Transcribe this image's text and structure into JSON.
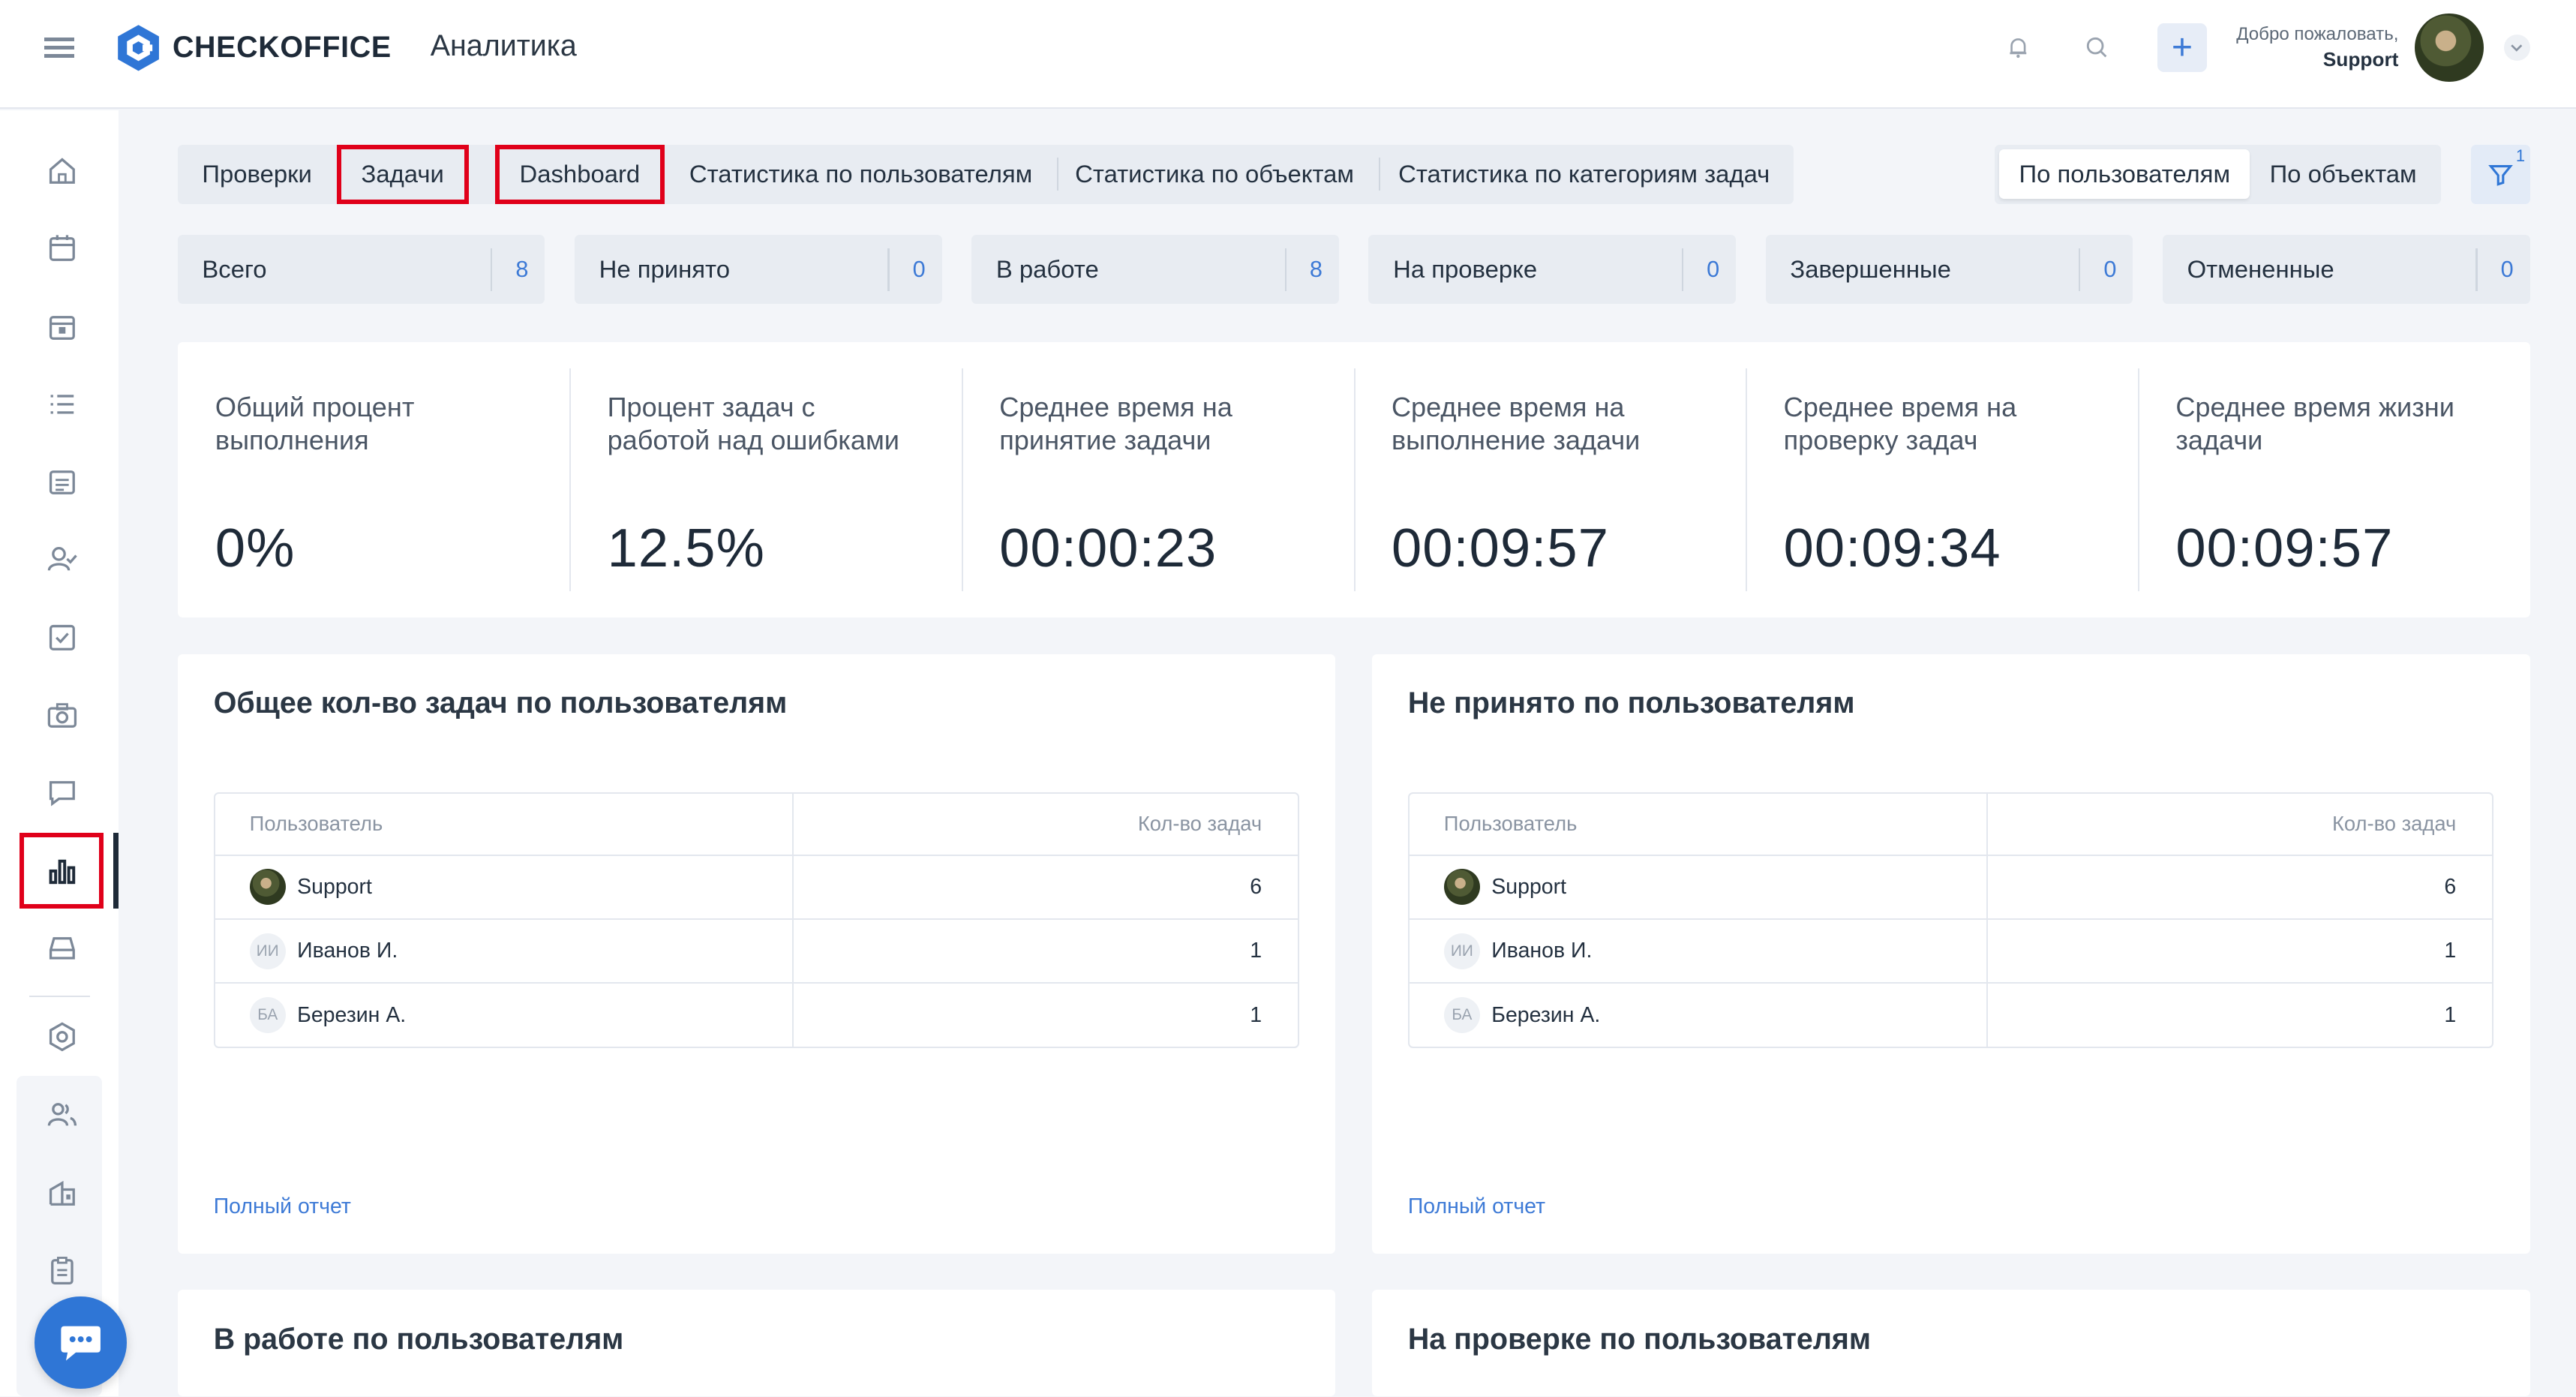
{
  "header": {
    "brand": "CHECKOFFICE",
    "page_title": "Аналитика",
    "welcome": "Добро пожаловать,",
    "user": "Support",
    "add_label": "+"
  },
  "sidebar": {
    "items": [
      "home-icon",
      "calendar-icon",
      "calendar-event-icon",
      "list-icon",
      "schedule-icon",
      "user-check-icon",
      "checkbox-icon",
      "camera-icon",
      "chat-icon",
      "analytics-icon",
      "inbox-icon",
      "settings-icon",
      "users-icon",
      "building-icon",
      "clipboard-icon"
    ],
    "active": "analytics-icon"
  },
  "tabs": {
    "items": [
      "Проверки",
      "Задачи",
      "Dashboard",
      "Статистика по пользователям",
      "Статистика по объектам",
      "Статистика по категориям задач"
    ]
  },
  "view_toggle": {
    "options": [
      "По пользователям",
      "По объектам"
    ],
    "active": "По пользователям"
  },
  "filter": {
    "count": "1"
  },
  "stats": [
    {
      "label": "Всего",
      "value": "8"
    },
    {
      "label": "Не принято",
      "value": "0"
    },
    {
      "label": "В работе",
      "value": "8"
    },
    {
      "label": "На проверке",
      "value": "0"
    },
    {
      "label": "Завершенные",
      "value": "0"
    },
    {
      "label": "Отмененные",
      "value": "0"
    }
  ],
  "kpis": [
    {
      "title": "Общий процент выполнения",
      "value": "0%"
    },
    {
      "title": "Процент задач с работой над ошибками",
      "value": "12.5%"
    },
    {
      "title": "Среднее время на принятие задачи",
      "value": "00:00:23"
    },
    {
      "title": "Среднее время на выполнение задачи",
      "value": "00:09:57"
    },
    {
      "title": "Среднее время на проверку задач",
      "value": "00:09:34"
    },
    {
      "title": "Среднее время жизни задачи",
      "value": "00:09:57"
    }
  ],
  "cards": [
    {
      "title": "Общее кол-во задач по пользователям",
      "col_user": "Пользователь",
      "col_count": "Кол-во задач",
      "rows": [
        {
          "initials": "",
          "name": "Support",
          "count": "6"
        },
        {
          "initials": "ИИ",
          "name": "Иванов И.",
          "count": "1"
        },
        {
          "initials": "БА",
          "name": "Березин А.",
          "count": "1"
        }
      ],
      "link": "Полный отчет"
    },
    {
      "title": "Не принято по пользователям",
      "col_user": "Пользователь",
      "col_count": "Кол-во задач",
      "rows": [
        {
          "initials": "",
          "name": "Support",
          "count": "6"
        },
        {
          "initials": "ИИ",
          "name": "Иванов И.",
          "count": "1"
        },
        {
          "initials": "БА",
          "name": "Березин А.",
          "count": "1"
        }
      ],
      "link": "Полный отчет"
    },
    {
      "title": "В работе по пользователям"
    },
    {
      "title": "На проверке по пользователям"
    }
  ],
  "colors": {
    "accent": "#3d7ad6",
    "highlight": "#e0001a",
    "chat": "#2f76d6"
  }
}
